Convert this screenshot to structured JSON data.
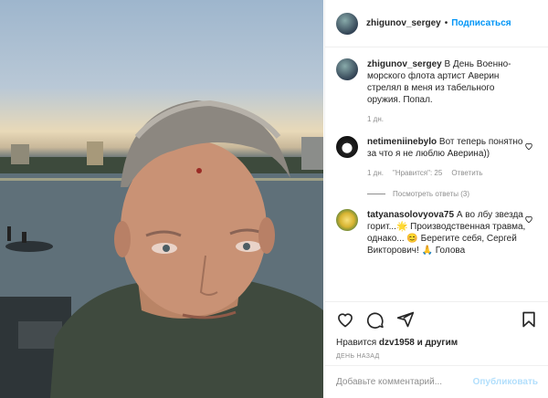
{
  "header": {
    "username": "zhigunov_sergey",
    "separator": "•",
    "follow_label": "Подписаться"
  },
  "caption": {
    "username": "zhigunov_sergey",
    "text": "В День Военно-морского флота артист Аверин стрелял в меня из табельного оружия. Попал.",
    "time": "1 дн."
  },
  "comments": [
    {
      "username": "netimeniinebylo",
      "text": "Вот теперь понятно за что я не люблю Аверина))",
      "time": "1 дн.",
      "likes": "\"Нравится\": 25",
      "reply": "Ответить"
    },
    {
      "username": "tatyanasolovyova75",
      "text": "А во лбу звезда горит...🌟 Производственная травма, однако... 😊 Берегите себя, Сергей Викторович! 🙏 Голова"
    }
  ],
  "view_replies": "Посмотреть ответы (3)",
  "likes": {
    "prefix": "Нравится",
    "user": "dzv1958",
    "suffix": "и другим"
  },
  "post_date": "ДЕНЬ НАЗАД",
  "add_comment": {
    "placeholder": "Добавьте комментарий...",
    "publish_label": "Опубликовать"
  },
  "icons": [
    "heart-icon",
    "comment-icon",
    "share-icon",
    "bookmark-icon"
  ]
}
